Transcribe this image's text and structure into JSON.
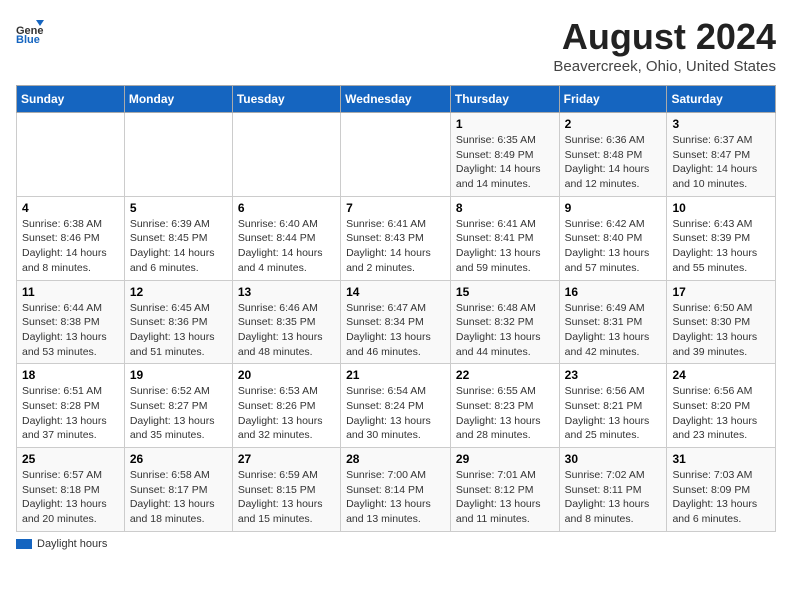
{
  "header": {
    "logo_general": "General",
    "logo_blue": "Blue",
    "title": "August 2024",
    "subtitle": "Beavercreek, Ohio, United States"
  },
  "legend": {
    "label": "Daylight hours"
  },
  "days_of_week": [
    "Sunday",
    "Monday",
    "Tuesday",
    "Wednesday",
    "Thursday",
    "Friday",
    "Saturday"
  ],
  "weeks": [
    [
      {
        "day": "",
        "info": ""
      },
      {
        "day": "",
        "info": ""
      },
      {
        "day": "",
        "info": ""
      },
      {
        "day": "",
        "info": ""
      },
      {
        "day": "1",
        "info": "Sunrise: 6:35 AM\nSunset: 8:49 PM\nDaylight: 14 hours and 14 minutes."
      },
      {
        "day": "2",
        "info": "Sunrise: 6:36 AM\nSunset: 8:48 PM\nDaylight: 14 hours and 12 minutes."
      },
      {
        "day": "3",
        "info": "Sunrise: 6:37 AM\nSunset: 8:47 PM\nDaylight: 14 hours and 10 minutes."
      }
    ],
    [
      {
        "day": "4",
        "info": "Sunrise: 6:38 AM\nSunset: 8:46 PM\nDaylight: 14 hours and 8 minutes."
      },
      {
        "day": "5",
        "info": "Sunrise: 6:39 AM\nSunset: 8:45 PM\nDaylight: 14 hours and 6 minutes."
      },
      {
        "day": "6",
        "info": "Sunrise: 6:40 AM\nSunset: 8:44 PM\nDaylight: 14 hours and 4 minutes."
      },
      {
        "day": "7",
        "info": "Sunrise: 6:41 AM\nSunset: 8:43 PM\nDaylight: 14 hours and 2 minutes."
      },
      {
        "day": "8",
        "info": "Sunrise: 6:41 AM\nSunset: 8:41 PM\nDaylight: 13 hours and 59 minutes."
      },
      {
        "day": "9",
        "info": "Sunrise: 6:42 AM\nSunset: 8:40 PM\nDaylight: 13 hours and 57 minutes."
      },
      {
        "day": "10",
        "info": "Sunrise: 6:43 AM\nSunset: 8:39 PM\nDaylight: 13 hours and 55 minutes."
      }
    ],
    [
      {
        "day": "11",
        "info": "Sunrise: 6:44 AM\nSunset: 8:38 PM\nDaylight: 13 hours and 53 minutes."
      },
      {
        "day": "12",
        "info": "Sunrise: 6:45 AM\nSunset: 8:36 PM\nDaylight: 13 hours and 51 minutes."
      },
      {
        "day": "13",
        "info": "Sunrise: 6:46 AM\nSunset: 8:35 PM\nDaylight: 13 hours and 48 minutes."
      },
      {
        "day": "14",
        "info": "Sunrise: 6:47 AM\nSunset: 8:34 PM\nDaylight: 13 hours and 46 minutes."
      },
      {
        "day": "15",
        "info": "Sunrise: 6:48 AM\nSunset: 8:32 PM\nDaylight: 13 hours and 44 minutes."
      },
      {
        "day": "16",
        "info": "Sunrise: 6:49 AM\nSunset: 8:31 PM\nDaylight: 13 hours and 42 minutes."
      },
      {
        "day": "17",
        "info": "Sunrise: 6:50 AM\nSunset: 8:30 PM\nDaylight: 13 hours and 39 minutes."
      }
    ],
    [
      {
        "day": "18",
        "info": "Sunrise: 6:51 AM\nSunset: 8:28 PM\nDaylight: 13 hours and 37 minutes."
      },
      {
        "day": "19",
        "info": "Sunrise: 6:52 AM\nSunset: 8:27 PM\nDaylight: 13 hours and 35 minutes."
      },
      {
        "day": "20",
        "info": "Sunrise: 6:53 AM\nSunset: 8:26 PM\nDaylight: 13 hours and 32 minutes."
      },
      {
        "day": "21",
        "info": "Sunrise: 6:54 AM\nSunset: 8:24 PM\nDaylight: 13 hours and 30 minutes."
      },
      {
        "day": "22",
        "info": "Sunrise: 6:55 AM\nSunset: 8:23 PM\nDaylight: 13 hours and 28 minutes."
      },
      {
        "day": "23",
        "info": "Sunrise: 6:56 AM\nSunset: 8:21 PM\nDaylight: 13 hours and 25 minutes."
      },
      {
        "day": "24",
        "info": "Sunrise: 6:56 AM\nSunset: 8:20 PM\nDaylight: 13 hours and 23 minutes."
      }
    ],
    [
      {
        "day": "25",
        "info": "Sunrise: 6:57 AM\nSunset: 8:18 PM\nDaylight: 13 hours and 20 minutes."
      },
      {
        "day": "26",
        "info": "Sunrise: 6:58 AM\nSunset: 8:17 PM\nDaylight: 13 hours and 18 minutes."
      },
      {
        "day": "27",
        "info": "Sunrise: 6:59 AM\nSunset: 8:15 PM\nDaylight: 13 hours and 15 minutes."
      },
      {
        "day": "28",
        "info": "Sunrise: 7:00 AM\nSunset: 8:14 PM\nDaylight: 13 hours and 13 minutes."
      },
      {
        "day": "29",
        "info": "Sunrise: 7:01 AM\nSunset: 8:12 PM\nDaylight: 13 hours and 11 minutes."
      },
      {
        "day": "30",
        "info": "Sunrise: 7:02 AM\nSunset: 8:11 PM\nDaylight: 13 hours and 8 minutes."
      },
      {
        "day": "31",
        "info": "Sunrise: 7:03 AM\nSunset: 8:09 PM\nDaylight: 13 hours and 6 minutes."
      }
    ]
  ]
}
